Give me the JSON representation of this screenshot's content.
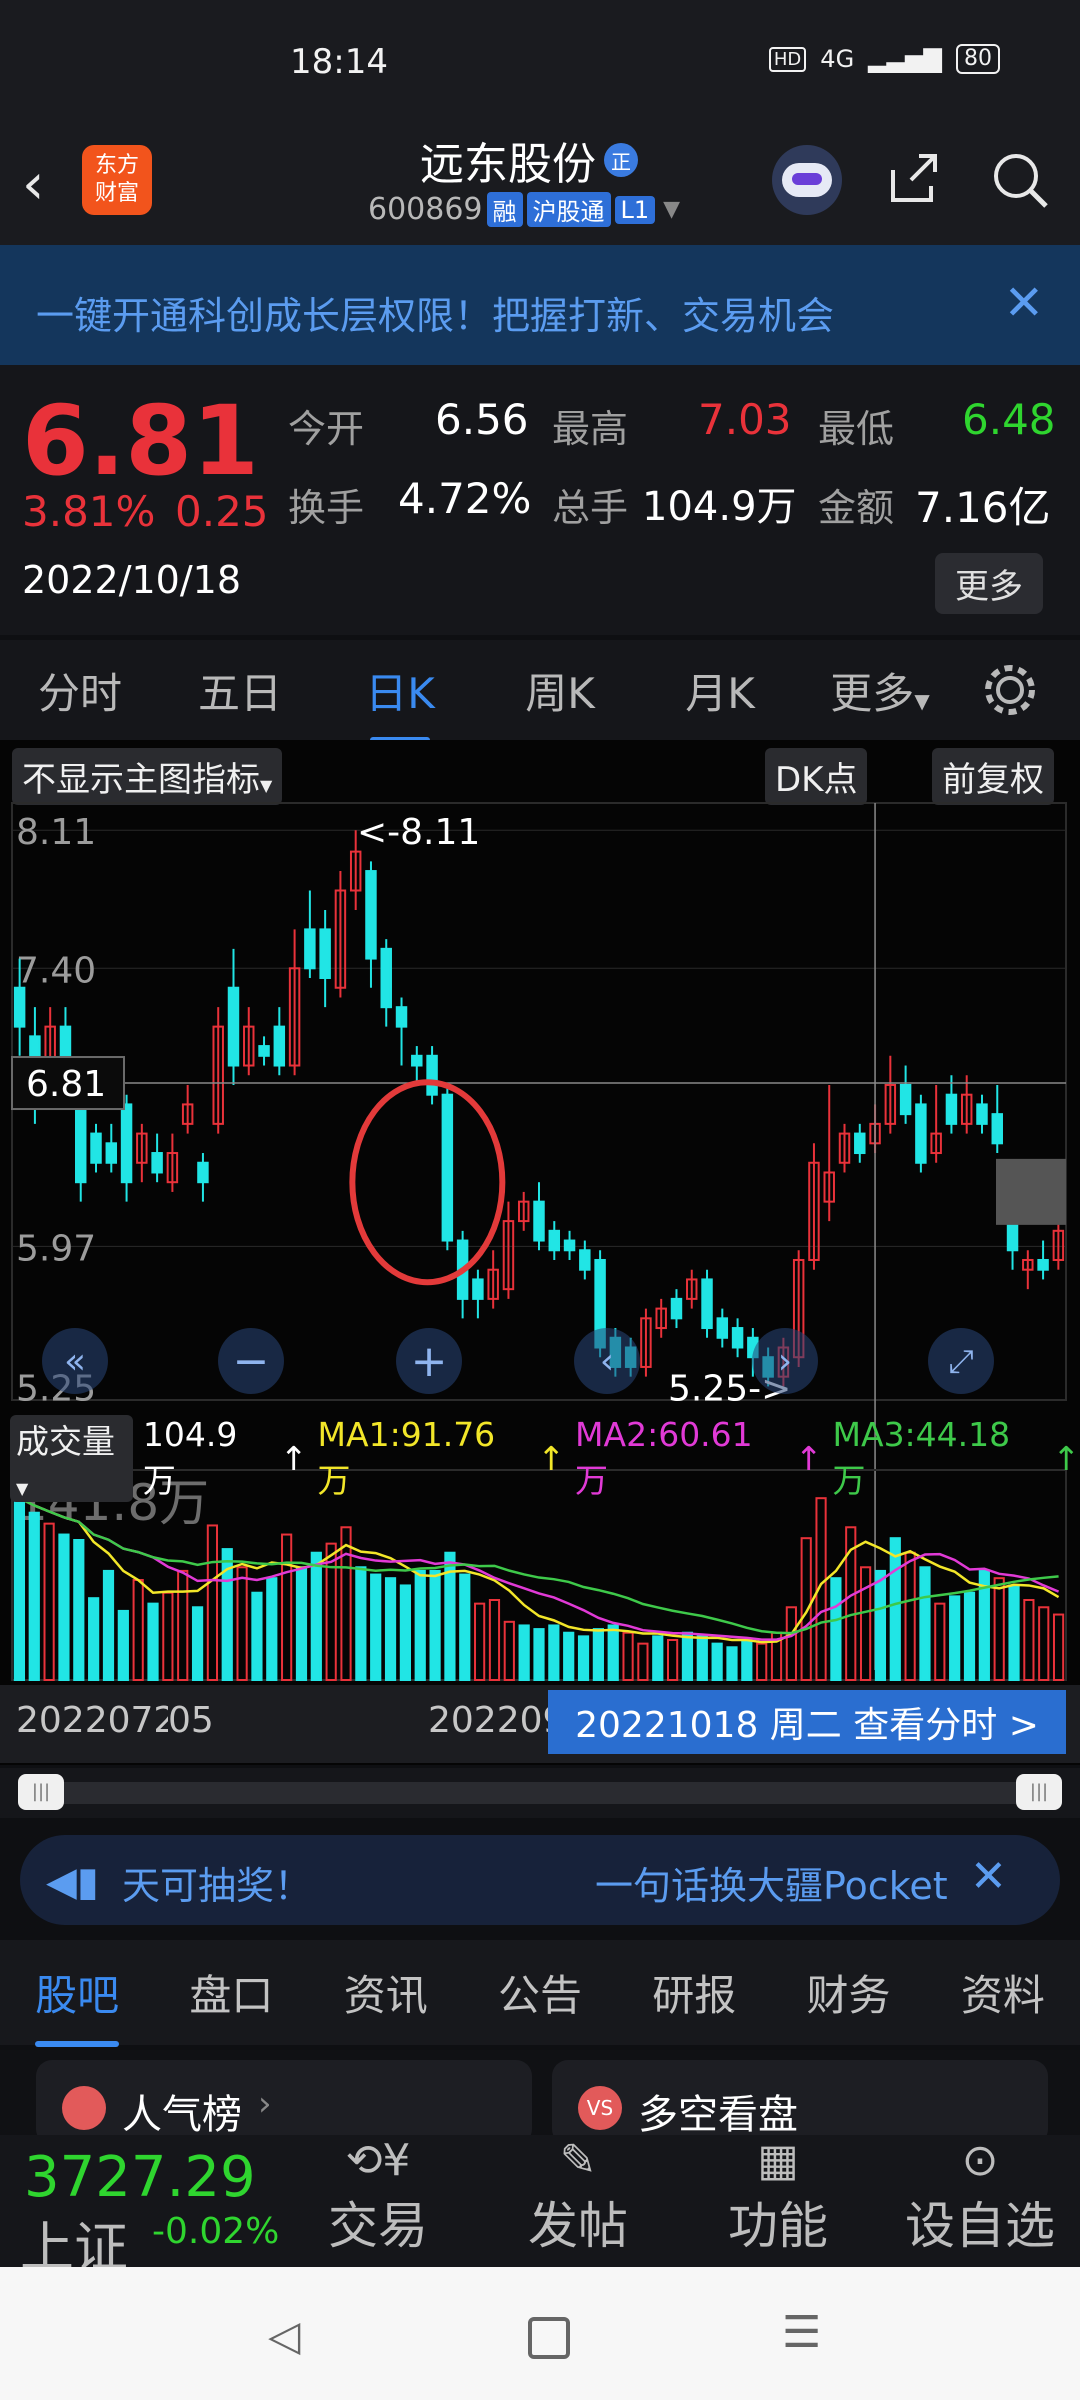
{
  "status": {
    "time": "18:14",
    "hd": "HD",
    "net": "4G",
    "battery": "80"
  },
  "header": {
    "logo_line1": "东方",
    "logo_line2": "财富",
    "name": "远东股份",
    "name_badge": "正",
    "code": "600869",
    "tags": [
      "融",
      "沪股通",
      "L1"
    ]
  },
  "banner": {
    "text": "一键开通科创成长层权限！把握打新、交易机会"
  },
  "quote": {
    "price": "6.81",
    "change_pct": "3.81%",
    "change": "0.25",
    "date": "2022/10/18",
    "open_label": "今开",
    "open": "6.56",
    "high_label": "最高",
    "high": "7.03",
    "low_label": "最低",
    "low": "6.48",
    "turnover_label": "换手",
    "turnover": "4.72%",
    "volume_label": "总手",
    "volume": "104.9万",
    "amount_label": "金额",
    "amount": "7.16亿",
    "more": "更多"
  },
  "period_tabs": [
    {
      "label": "分时"
    },
    {
      "label": "五日"
    },
    {
      "label": "日K"
    },
    {
      "label": "周K"
    },
    {
      "label": "月K"
    },
    {
      "label": "更多"
    }
  ],
  "chart_toolbar": {
    "indicator": "不显示主图指标",
    "dk": "DK点",
    "adjust": "前复权"
  },
  "chart_data": {
    "type": "candlestick",
    "y_ticks": [
      "8.11",
      "7.40",
      "5.97",
      "5.25"
    ],
    "current_price_label": "6.81",
    "max_label": "<-8.11",
    "min_label": "5.25->",
    "candles": [
      {
        "o": 7.3,
        "c": 7.1,
        "h": 7.45,
        "l": 6.95,
        "up": false
      },
      {
        "o": 7.05,
        "c": 6.7,
        "h": 7.2,
        "l": 6.6,
        "up": false
      },
      {
        "o": 6.85,
        "c": 7.1,
        "h": 7.2,
        "l": 6.8,
        "up": true
      },
      {
        "o": 7.1,
        "c": 6.9,
        "h": 7.2,
        "l": 6.85,
        "up": false
      },
      {
        "o": 6.75,
        "c": 6.3,
        "h": 6.8,
        "l": 6.2,
        "up": false
      },
      {
        "o": 6.55,
        "c": 6.4,
        "h": 6.6,
        "l": 6.35,
        "up": false
      },
      {
        "o": 6.5,
        "c": 6.4,
        "h": 6.6,
        "l": 6.35,
        "up": false
      },
      {
        "o": 6.7,
        "c": 6.3,
        "h": 6.75,
        "l": 6.2,
        "up": false
      },
      {
        "o": 6.4,
        "c": 6.55,
        "h": 6.6,
        "l": 6.3,
        "up": true
      },
      {
        "o": 6.45,
        "c": 6.35,
        "h": 6.55,
        "l": 6.3,
        "up": false
      },
      {
        "o": 6.3,
        "c": 6.45,
        "h": 6.55,
        "l": 6.25,
        "up": true
      },
      {
        "o": 6.6,
        "c": 6.7,
        "h": 6.8,
        "l": 6.55,
        "up": true
      },
      {
        "o": 6.4,
        "c": 6.3,
        "h": 6.45,
        "l": 6.2,
        "up": false
      },
      {
        "o": 6.6,
        "c": 7.1,
        "h": 7.2,
        "l": 6.55,
        "up": true
      },
      {
        "o": 7.3,
        "c": 6.9,
        "h": 7.5,
        "l": 6.8,
        "up": false
      },
      {
        "o": 6.9,
        "c": 7.1,
        "h": 7.2,
        "l": 6.85,
        "up": true
      },
      {
        "o": 7.0,
        "c": 6.95,
        "h": 7.05,
        "l": 6.9,
        "up": false
      },
      {
        "o": 7.1,
        "c": 6.9,
        "h": 7.2,
        "l": 6.85,
        "up": false
      },
      {
        "o": 6.9,
        "c": 7.4,
        "h": 7.6,
        "l": 6.85,
        "up": true
      },
      {
        "o": 7.6,
        "c": 7.4,
        "h": 7.8,
        "l": 7.35,
        "up": false
      },
      {
        "o": 7.6,
        "c": 7.35,
        "h": 7.7,
        "l": 7.2,
        "up": false
      },
      {
        "o": 7.3,
        "c": 7.8,
        "h": 7.9,
        "l": 7.25,
        "up": true
      },
      {
        "o": 7.8,
        "c": 8.0,
        "h": 8.11,
        "l": 7.7,
        "up": true
      },
      {
        "o": 7.9,
        "c": 7.45,
        "h": 7.95,
        "l": 7.3,
        "up": false
      },
      {
        "o": 7.5,
        "c": 7.2,
        "h": 7.55,
        "l": 7.1,
        "up": false
      },
      {
        "o": 7.2,
        "c": 7.1,
        "h": 7.25,
        "l": 6.9,
        "up": false
      },
      {
        "o": 6.95,
        "c": 6.9,
        "h": 7.0,
        "l": 6.8,
        "up": false
      },
      {
        "o": 6.95,
        "c": 6.75,
        "h": 7.0,
        "l": 6.7,
        "up": false
      },
      {
        "o": 6.75,
        "c": 6.0,
        "h": 6.8,
        "l": 5.95,
        "up": false
      },
      {
        "o": 6.0,
        "c": 5.7,
        "h": 6.05,
        "l": 5.6,
        "up": false
      },
      {
        "o": 5.8,
        "c": 5.7,
        "h": 5.85,
        "l": 5.6,
        "up": false
      },
      {
        "o": 5.7,
        "c": 5.85,
        "h": 5.95,
        "l": 5.65,
        "up": true
      },
      {
        "o": 5.75,
        "c": 6.1,
        "h": 6.2,
        "l": 5.7,
        "up": true
      },
      {
        "o": 6.1,
        "c": 6.2,
        "h": 6.25,
        "l": 6.05,
        "up": true
      },
      {
        "o": 6.2,
        "c": 6.0,
        "h": 6.3,
        "l": 5.95,
        "up": false
      },
      {
        "o": 6.05,
        "c": 5.95,
        "h": 6.1,
        "l": 5.9,
        "up": false
      },
      {
        "o": 6.0,
        "c": 5.95,
        "h": 6.05,
        "l": 5.9,
        "up": false
      },
      {
        "o": 5.95,
        "c": 5.85,
        "h": 6.0,
        "l": 5.8,
        "up": false
      },
      {
        "o": 5.9,
        "c": 5.45,
        "h": 5.95,
        "l": 5.4,
        "up": false
      },
      {
        "o": 5.5,
        "c": 5.35,
        "h": 5.55,
        "l": 5.3,
        "up": false
      },
      {
        "o": 5.45,
        "c": 5.35,
        "h": 5.5,
        "l": 5.3,
        "up": false
      },
      {
        "o": 5.35,
        "c": 5.6,
        "h": 5.65,
        "l": 5.3,
        "up": true
      },
      {
        "o": 5.55,
        "c": 5.65,
        "h": 5.7,
        "l": 5.5,
        "up": true
      },
      {
        "o": 5.7,
        "c": 5.6,
        "h": 5.75,
        "l": 5.55,
        "up": false
      },
      {
        "o": 5.7,
        "c": 5.8,
        "h": 5.85,
        "l": 5.65,
        "up": true
      },
      {
        "o": 5.8,
        "c": 5.55,
        "h": 5.85,
        "l": 5.5,
        "up": false
      },
      {
        "o": 5.6,
        "c": 5.5,
        "h": 5.65,
        "l": 5.45,
        "up": false
      },
      {
        "o": 5.55,
        "c": 5.45,
        "h": 5.6,
        "l": 5.4,
        "up": false
      },
      {
        "o": 5.5,
        "c": 5.4,
        "h": 5.55,
        "l": 5.3,
        "up": false
      },
      {
        "o": 5.4,
        "c": 5.3,
        "h": 5.45,
        "l": 5.25,
        "up": false
      },
      {
        "o": 5.3,
        "c": 5.45,
        "h": 5.5,
        "l": 5.25,
        "up": true
      },
      {
        "o": 5.4,
        "c": 5.9,
        "h": 5.95,
        "l": 5.35,
        "up": true
      },
      {
        "o": 5.9,
        "c": 6.4,
        "h": 6.5,
        "l": 5.85,
        "up": true
      },
      {
        "o": 6.2,
        "c": 6.35,
        "h": 6.8,
        "l": 6.1,
        "up": true
      },
      {
        "o": 6.4,
        "c": 6.55,
        "h": 6.6,
        "l": 6.35,
        "up": true
      },
      {
        "o": 6.55,
        "c": 6.45,
        "h": 6.6,
        "l": 6.4,
        "up": false
      },
      {
        "o": 6.5,
        "c": 6.6,
        "h": 6.7,
        "l": 6.45,
        "up": true
      },
      {
        "o": 6.6,
        "c": 6.8,
        "h": 6.95,
        "l": 6.55,
        "up": true
      },
      {
        "o": 6.8,
        "c": 6.65,
        "h": 6.9,
        "l": 6.6,
        "up": false
      },
      {
        "o": 6.7,
        "c": 6.4,
        "h": 6.75,
        "l": 6.35,
        "up": false
      },
      {
        "o": 6.45,
        "c": 6.55,
        "h": 6.8,
        "l": 6.4,
        "up": true
      },
      {
        "o": 6.75,
        "c": 6.6,
        "h": 6.85,
        "l": 6.55,
        "up": false
      },
      {
        "o": 6.6,
        "c": 6.75,
        "h": 6.85,
        "l": 6.55,
        "up": true
      },
      {
        "o": 6.7,
        "c": 6.6,
        "h": 6.75,
        "l": 6.55,
        "up": false
      },
      {
        "o": 6.65,
        "c": 6.5,
        "h": 6.8,
        "l": 6.45,
        "up": false
      },
      {
        "o": 6.3,
        "c": 5.95,
        "h": 6.35,
        "l": 5.85,
        "up": false
      },
      {
        "o": 5.85,
        "c": 5.9,
        "h": 5.95,
        "l": 5.75,
        "up": true
      },
      {
        "o": 5.9,
        "c": 5.85,
        "h": 6.0,
        "l": 5.8,
        "up": false
      },
      {
        "o": 5.9,
        "c": 6.05,
        "h": 6.1,
        "l": 5.85,
        "up": true
      }
    ],
    "circle_marker": "red circle highlighting large bearish candle",
    "volume_legend": {
      "label": "成交量",
      "vol": "104.9万",
      "ma1": "MA1:91.76万",
      "ma2": "MA2:60.61万",
      "ma3": "MA3:44.18万"
    },
    "volume_axis_max": "141.8万",
    "volumes": [
      100,
      92,
      86,
      80,
      77,
      45,
      60,
      38,
      55,
      42,
      48,
      60,
      40,
      85,
      72,
      62,
      48,
      56,
      80,
      62,
      70,
      75,
      84,
      62,
      58,
      56,
      52,
      60,
      60,
      70,
      58,
      42,
      44,
      32,
      30,
      28,
      30,
      26,
      24,
      28,
      30,
      26,
      20,
      24,
      22,
      26,
      24,
      20,
      18,
      22,
      20,
      26,
      40,
      78,
      100,
      56,
      84,
      62,
      60,
      78,
      70,
      62,
      42,
      46,
      48,
      60,
      56,
      52,
      44,
      40,
      36
    ],
    "ma_colors": {
      "ma1": "#f2e629",
      "ma2": "#e13ad6",
      "ma3": "#3ec94a"
    },
    "x_labels": [
      "20220726",
      "20220905",
      "2022090"
    ],
    "crosshair_label": "20221018 周二 查看分时 >",
    "colors": {
      "up": "#e9323a",
      "down": "#21e5e5"
    }
  },
  "ad": {
    "left": "天可抽奖！",
    "right": "一句话换大疆Pocket"
  },
  "bottom_tabs": [
    {
      "label": "股吧"
    },
    {
      "label": "盘口"
    },
    {
      "label": "资讯"
    },
    {
      "label": "公告"
    },
    {
      "label": "研报"
    },
    {
      "label": "财务"
    },
    {
      "label": "资料"
    }
  ],
  "cards": [
    {
      "label": "人气榜"
    },
    {
      "label": "多空看盘"
    }
  ],
  "nav": {
    "index_value": "3727.29",
    "index_name": "上证",
    "index_change": "-0.02%",
    "items": [
      {
        "label": "交易"
      },
      {
        "label": "发帖"
      },
      {
        "label": "功能"
      },
      {
        "label": "设自选"
      }
    ]
  }
}
